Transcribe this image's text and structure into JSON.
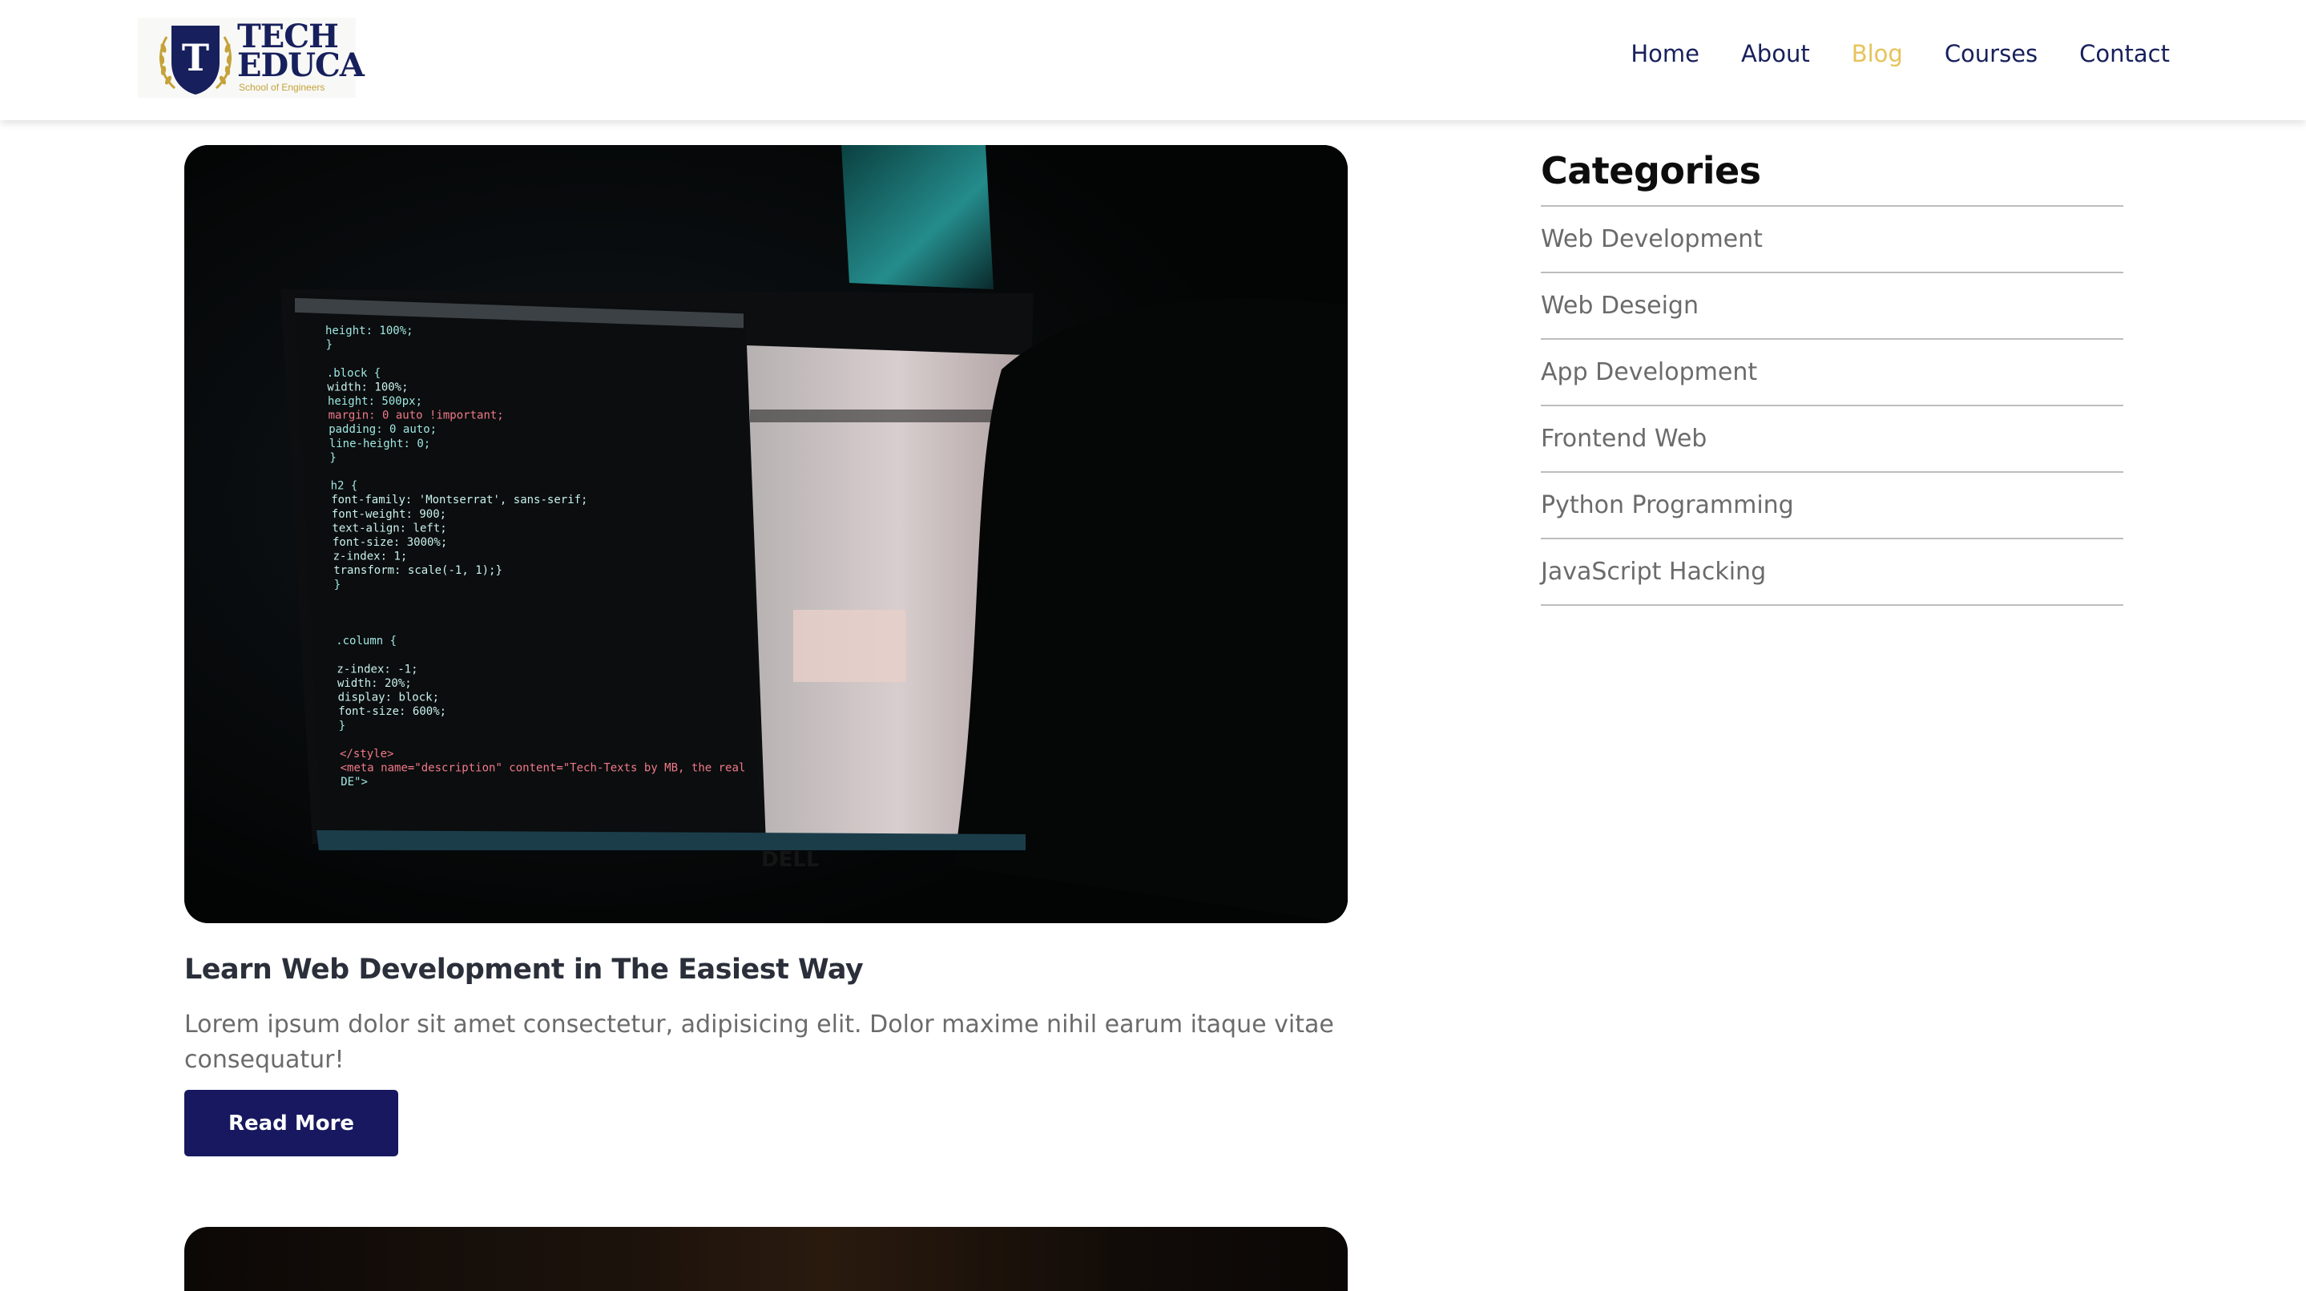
{
  "brand": {
    "line1": "TECH",
    "line2": "EDUCA",
    "tagline": "School of Engineers",
    "shield_letter": "T",
    "colors": {
      "navy": "#17205c",
      "gold": "#c5a23a"
    }
  },
  "nav": {
    "items": [
      {
        "label": "Home",
        "active": false
      },
      {
        "label": "About",
        "active": false
      },
      {
        "label": "Blog",
        "active": true
      },
      {
        "label": "Courses",
        "active": false
      },
      {
        "label": "Contact",
        "active": false
      }
    ],
    "active_color": "#e6c35a"
  },
  "post": {
    "title": "Learn Web Development in The Easiest Way",
    "excerpt": "Lorem ipsum dolor sit amet consectetur, adipisicing elit. Dolor maxime nihil earum itaque vitae consequatur!",
    "read_more_label": "Read More",
    "image": {
      "code_lines": [
        "height: 100%;",
        "}",
        "",
        ".block {",
        "width: 100%;",
        "height: 500px;",
        "margin: 0 auto !important;",
        "padding: 0 auto;",
        "line-height: 0;",
        "}",
        "",
        "h2 {",
        "    font-family: 'Montserrat', sans-serif;",
        "    font-weight: 900;",
        "    text-align: left;",
        "    font-size: 3000%;",
        "    z-index: 1;",
        "    transform: scale(-1, 1);}",
        "}",
        "",
        "",
        "",
        ".column {",
        "",
        "    z-index: -1;",
        "    width: 20%;",
        "    display: block;",
        "    font-size: 600%;",
        "}",
        "",
        "</style>",
        "  <meta name=\"description\" content=\"Tech-Texts by MB, the real",
        "  DE\">"
      ],
      "monitor_brand": "DELL"
    }
  },
  "sidebar": {
    "title": "Categories",
    "categories": [
      "Web Development",
      "Web Deseign",
      "App Development",
      "Frontend Web",
      "Python Programming",
      "JavaScript Hacking"
    ]
  }
}
